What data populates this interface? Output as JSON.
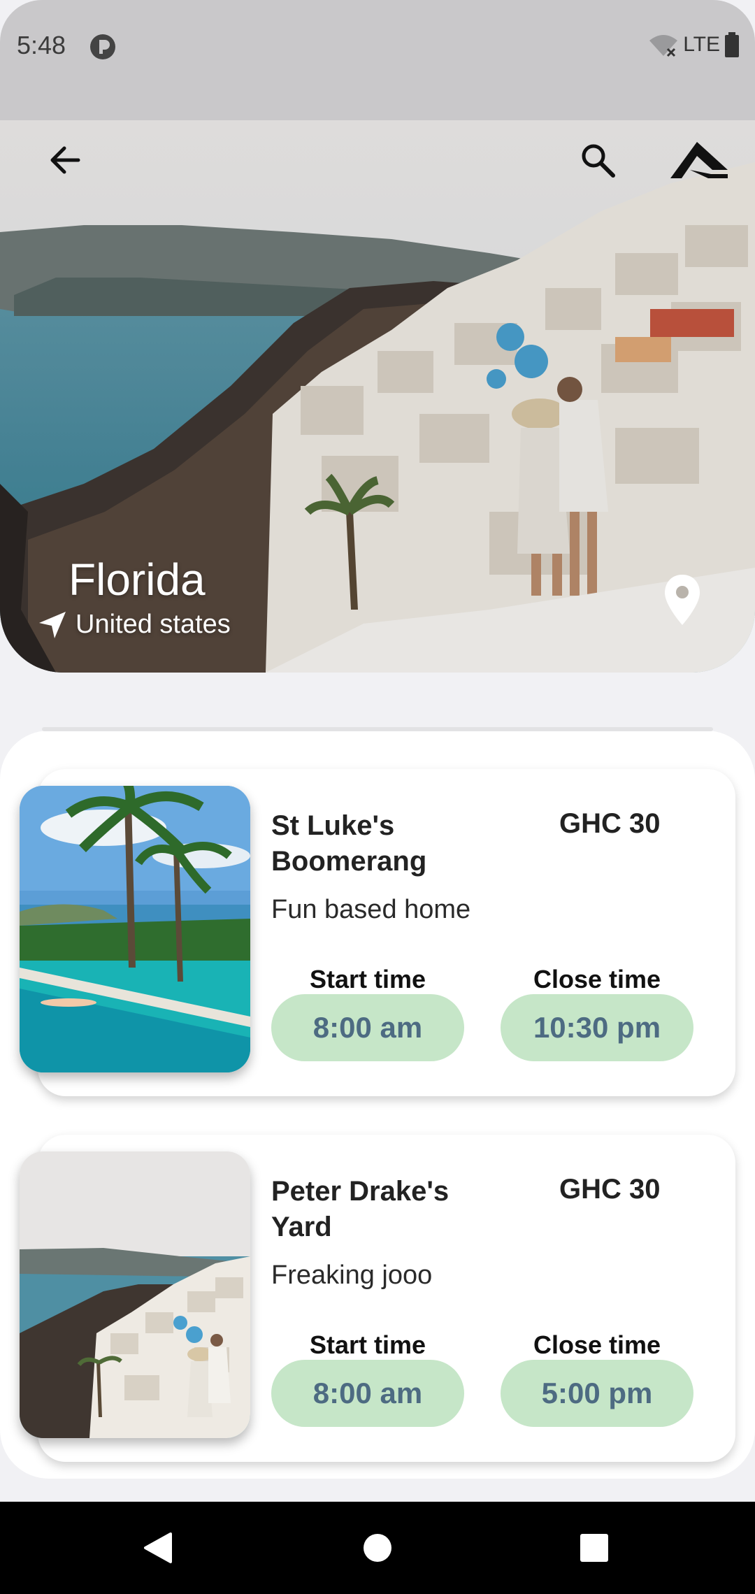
{
  "status_bar": {
    "time": "5:48",
    "network": "LTE"
  },
  "hero": {
    "title": "Florida",
    "subtitle": "United states"
  },
  "places": [
    {
      "name": "St Luke's Boomerang",
      "price": "GHC 30",
      "description": "Fun based home",
      "start_label": "Start time",
      "close_label": "Close time",
      "start_time": "8:00 am",
      "close_time": "10:30 pm"
    },
    {
      "name": "Peter Drake's Yard",
      "price": "GHC 30",
      "description": "Freaking jooo",
      "start_label": "Start time",
      "close_label": "Close time",
      "start_time": "8:00 am",
      "close_time": "5:00 pm"
    }
  ],
  "colors": {
    "pill_bg": "#c6e6c8",
    "pill_text": "#4d6b82",
    "status_bar": "#c9c8ca"
  },
  "icons": [
    "back-arrow-icon",
    "search-icon",
    "app-logo-icon",
    "navigation-arrow-icon",
    "location-pin-icon",
    "nav-back-icon",
    "nav-home-icon",
    "nav-recents-icon"
  ]
}
